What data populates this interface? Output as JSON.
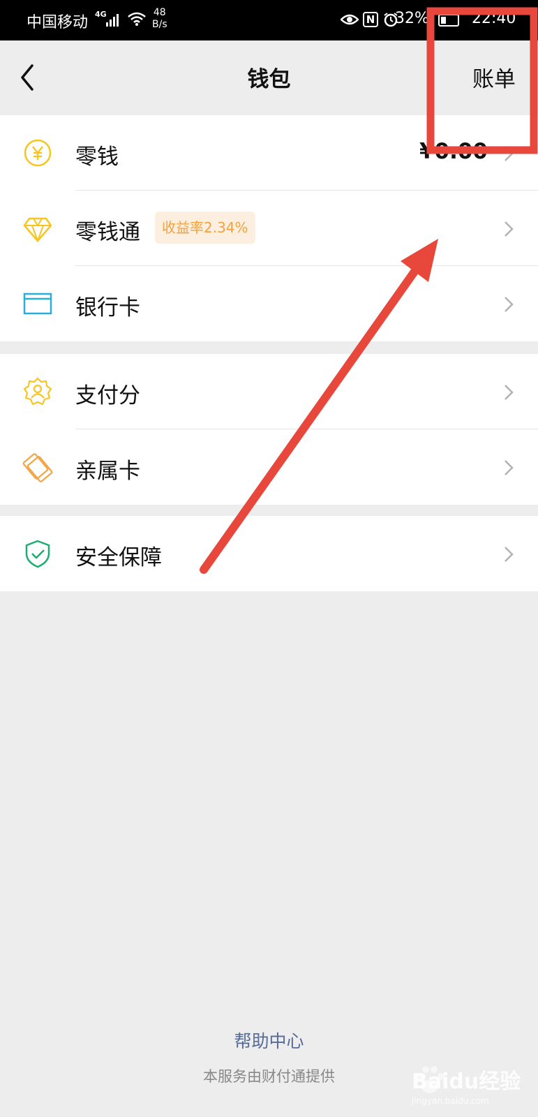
{
  "status_bar": {
    "carrier": "中国移动",
    "network": "4G",
    "speed_value": "48",
    "speed_unit": "B/s",
    "nfc": "N",
    "battery_percent": "32%",
    "battery_level": 0.32,
    "time": "22:40"
  },
  "nav": {
    "title": "钱包",
    "bill_label": "账单"
  },
  "groups": [
    {
      "items": [
        {
          "label": "零钱",
          "icon": "yuan-coin-icon",
          "value": "¥0.00"
        },
        {
          "label": "零钱通",
          "icon": "diamond-icon",
          "badge": "收益率2.34%"
        },
        {
          "label": "银行卡",
          "icon": "bank-card-icon"
        }
      ]
    },
    {
      "items": [
        {
          "label": "支付分",
          "icon": "payscore-icon"
        },
        {
          "label": "亲属卡",
          "icon": "family-card-icon"
        }
      ]
    },
    {
      "items": [
        {
          "label": "安全保障",
          "icon": "shield-icon"
        }
      ]
    }
  ],
  "footer": {
    "help": "帮助中心",
    "provider": "本服务由财付通提供"
  },
  "watermark": {
    "brand": "Baidu经验",
    "url": "jingyan.baidu.com"
  },
  "colors": {
    "annotation_red": "#e8483b",
    "yellow_icon": "#f7c51e",
    "blue_icon": "#2aaed8",
    "orange_icon": "#f3a64a",
    "green_icon": "#1aad6f",
    "link_blue": "#576b95",
    "badge_bg": "#fdefe0",
    "badge_text": "#f2a13c"
  }
}
